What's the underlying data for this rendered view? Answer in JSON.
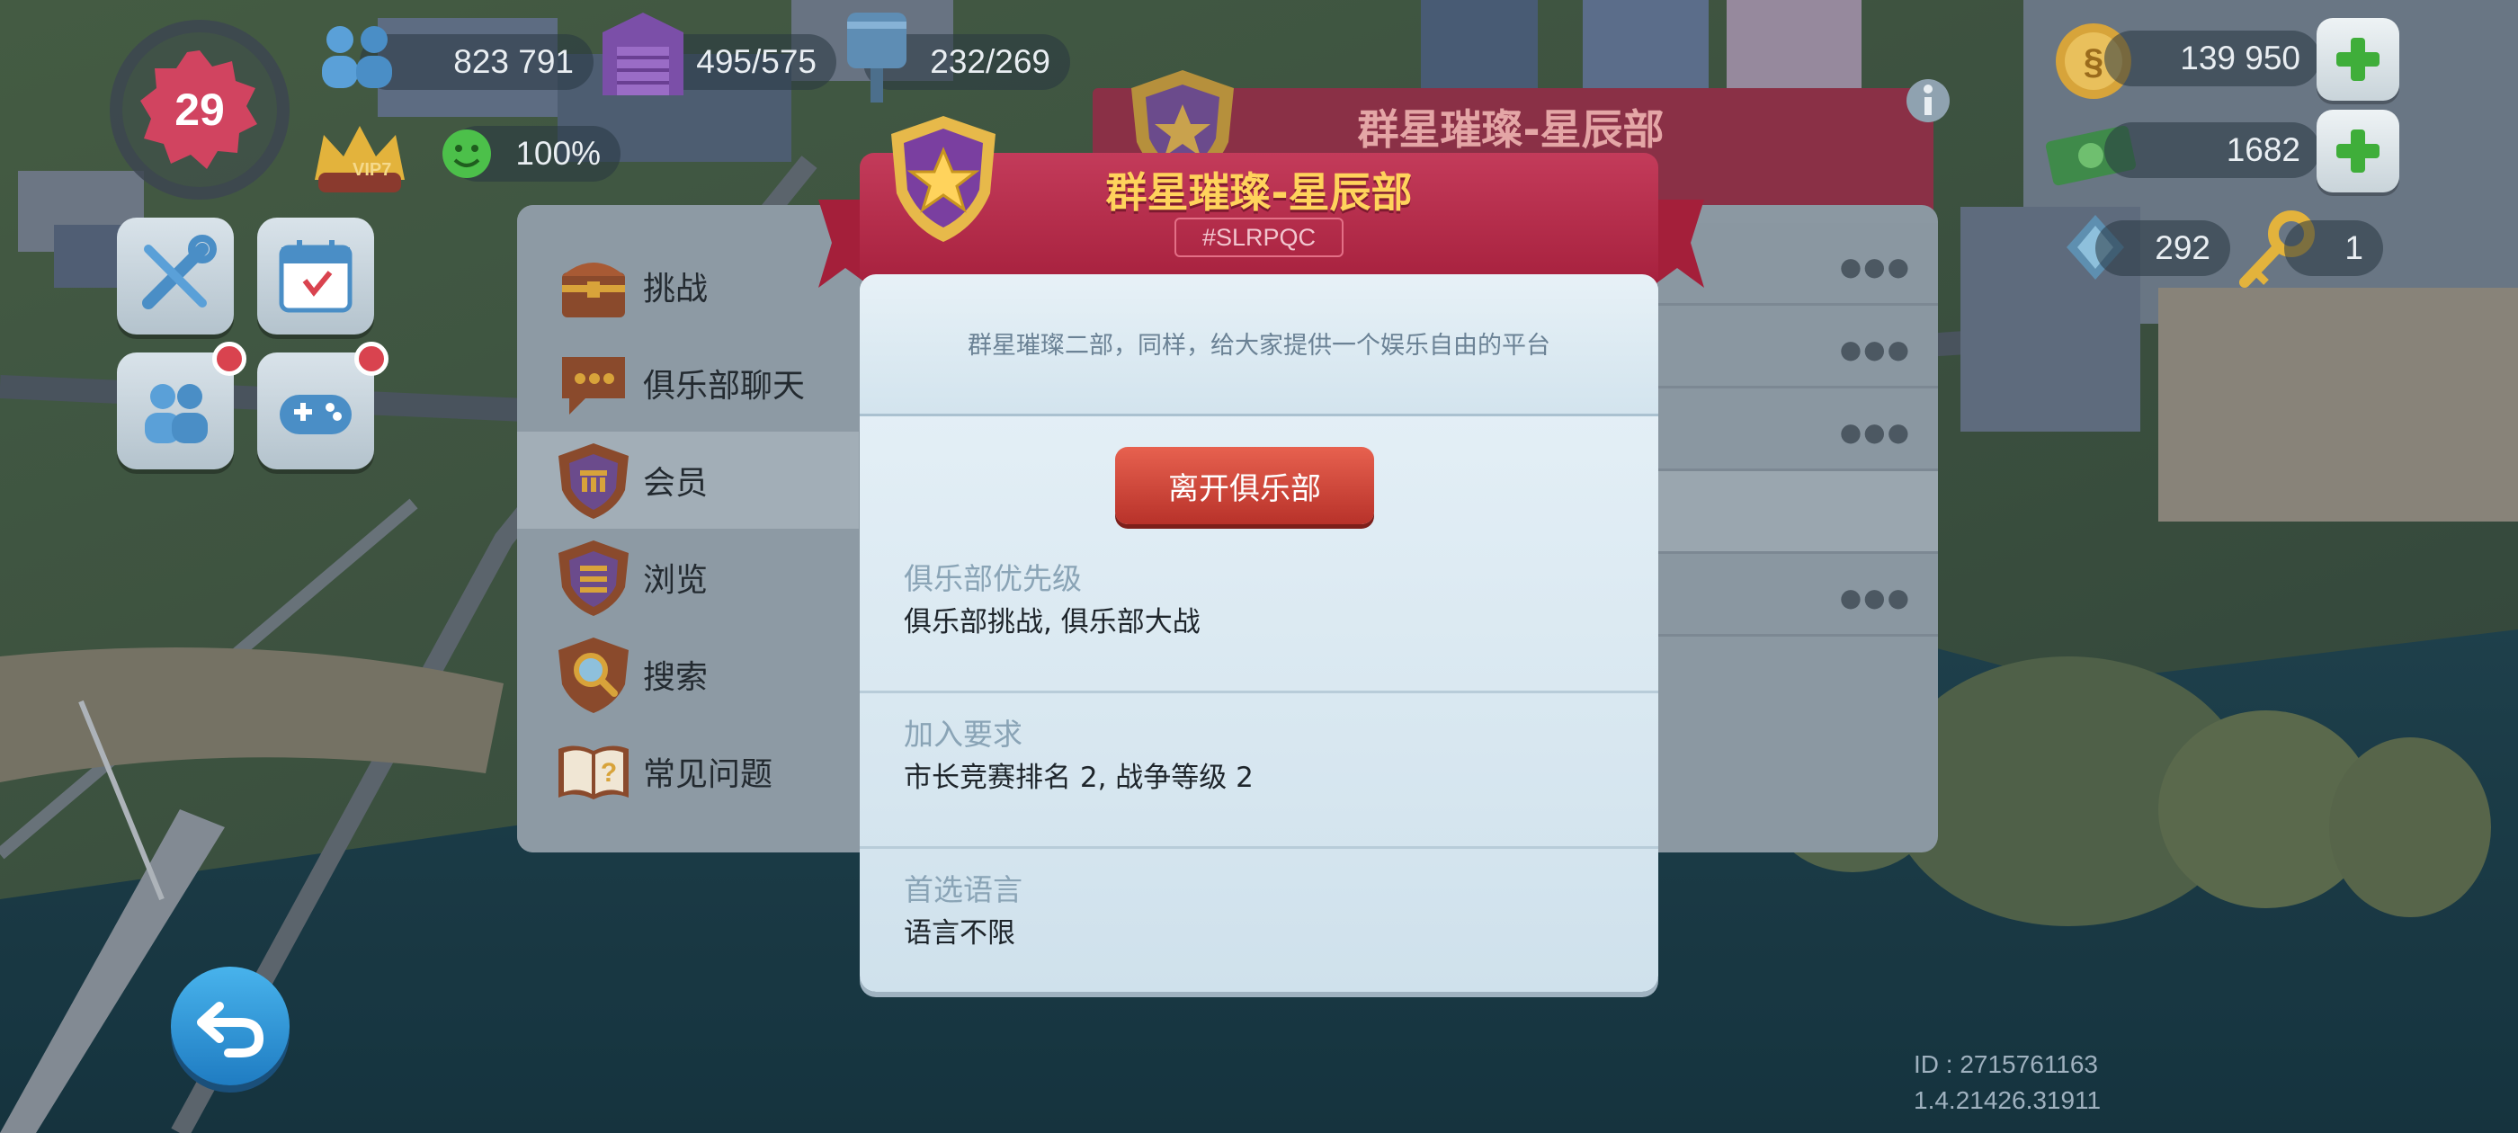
{
  "hud": {
    "level": "29",
    "population": "823 791",
    "storage": "495/575",
    "water": "232/269",
    "happiness": "100%",
    "vip_label": "VIP7",
    "simoleons": "139 950",
    "simcash": "1682",
    "neosimoleons": "292",
    "keys": "1"
  },
  "bg_club": {
    "title": "群星璀璨-星辰部"
  },
  "menu": {
    "items": [
      {
        "label": "挑战",
        "icon": "treasure-chest-icon"
      },
      {
        "label": "俱乐部聊天",
        "icon": "chat-bubble-icon"
      },
      {
        "label": "会员",
        "icon": "members-shield-icon"
      },
      {
        "label": "浏览",
        "icon": "browse-shield-icon"
      },
      {
        "label": "搜索",
        "icon": "search-shield-icon"
      },
      {
        "label": "常见问题",
        "icon": "faq-book-icon"
      }
    ]
  },
  "modal": {
    "title": "群星璀璨-星辰部",
    "tag": "#SLRPQC",
    "description": "群星璀璨二部，同样，给大家提供一个娱乐自由的平台",
    "leave_button": "离开俱乐部",
    "priority_label": "俱乐部优先级",
    "priority_value": "俱乐部挑战, 俱乐部大战",
    "requirements_label": "加入要求",
    "requirements_value": "市长竞赛排名 2, 战争等级 2",
    "language_label": "首选语言",
    "language_value": "语言不限"
  },
  "footer": {
    "id": "ID : 2715761163",
    "version": "1.4.21426.31911"
  },
  "colors": {
    "header_red": "#b32c4a",
    "title_gold": "#ffd35c",
    "leave_red": "#d04a3b",
    "body_blue": "#dde9f1"
  }
}
